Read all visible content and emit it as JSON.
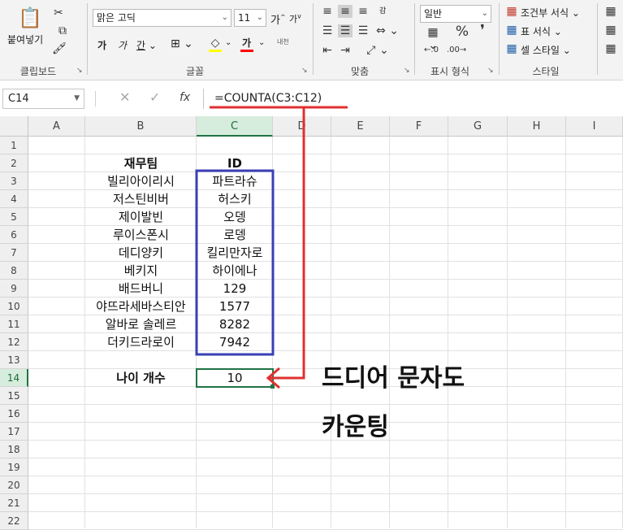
{
  "ribbon": {
    "clipboard": {
      "paste_label": "붙여넣기",
      "group_label": "클립보드"
    },
    "font": {
      "font_name": "맑은 고딕",
      "font_size": "11",
      "grow": "가",
      "shrink": "가",
      "bold": "가",
      "italic": "가",
      "underline": "간",
      "border": "⊞",
      "fill_color": "#ffff00",
      "font_color_label": "가",
      "font_color": "#ff0000",
      "phonetic": "내천",
      "group_label": "글꼴"
    },
    "alignment": {
      "group_label": "맞춤",
      "wrap": "감"
    },
    "number": {
      "format": "일반",
      "group_label": "표시 형식"
    },
    "styles": {
      "conditional": "조건부 서식",
      "table": "표 서식",
      "cell": "셀 스타일",
      "group_label": "스타일"
    }
  },
  "formula_bar": {
    "name_box": "C14",
    "cancel": "✕",
    "enter": "✓",
    "fx": "fx",
    "formula": "=COUNTA(C3:C12)"
  },
  "sheet": {
    "columns": [
      "A",
      "B",
      "C",
      "D",
      "E",
      "F",
      "G",
      "H",
      "I"
    ],
    "selected_column": "C",
    "rows": [
      "1",
      "2",
      "3",
      "4",
      "5",
      "6",
      "7",
      "8",
      "9",
      "10",
      "11",
      "12",
      "13",
      "14",
      "15",
      "16",
      "17",
      "18",
      "19",
      "20",
      "21",
      "22"
    ],
    "selected_row": "14",
    "header_b": "재무팀",
    "header_c": "ID",
    "names": [
      "빌리아이리시",
      "저스틴비버",
      "제이발빈",
      "루이스폰시",
      "데디양키",
      "베키지",
      "배드버니",
      "야뜨라세바스티안",
      "알바로 솔레르",
      "더키드라로이"
    ],
    "ids": [
      "파트라슈",
      "허스키",
      "오뎅",
      "로뎅",
      "킬리만자로",
      "하이에나",
      "129",
      "1577",
      "8282",
      "7942"
    ],
    "count_label": "나이 개수",
    "count_value": "10"
  },
  "annotation": {
    "line1": "드디어 문자도",
    "line2": "카운팅",
    "highlight_color": "#3a3fb5",
    "arrow_color": "#e03030"
  }
}
